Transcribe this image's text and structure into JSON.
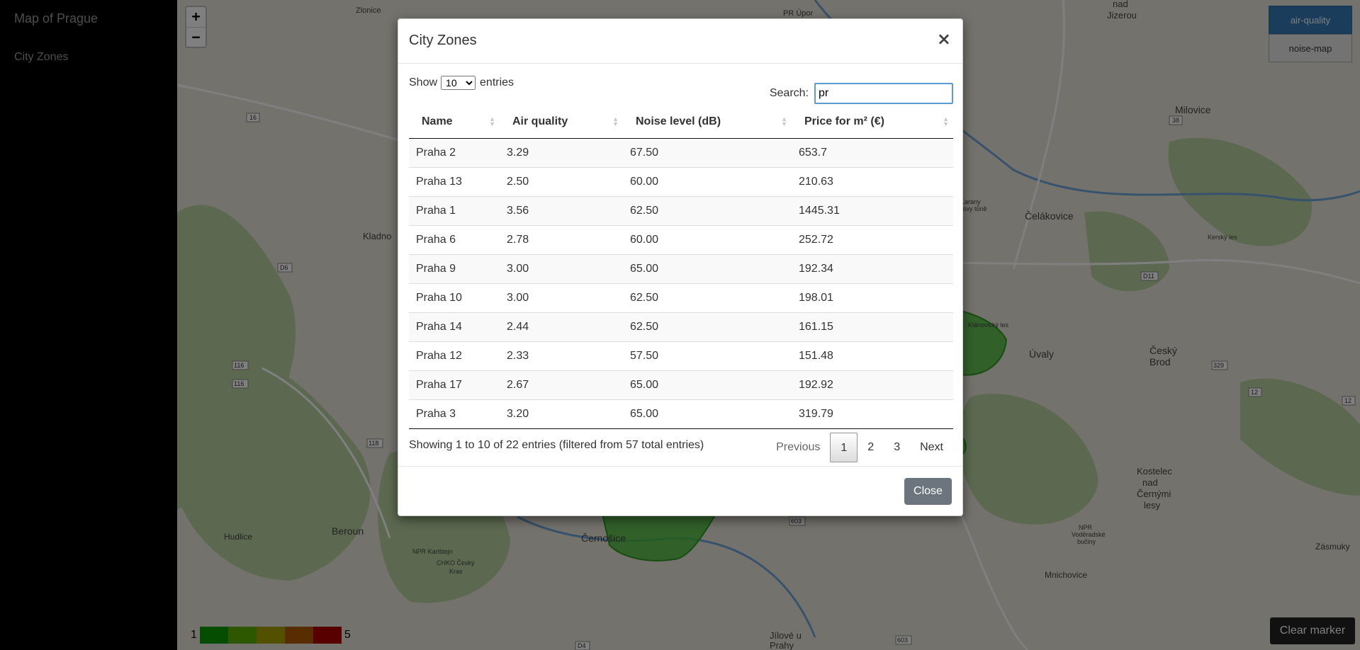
{
  "sidebar": {
    "brand": "Map of Prague",
    "items": [
      {
        "label": "City Zones"
      }
    ]
  },
  "map": {
    "zoom_in": "+",
    "zoom_out": "−",
    "layers": [
      {
        "label": "air-quality",
        "active": true
      },
      {
        "label": "noise-map",
        "active": false
      }
    ],
    "place_labels": [
      "Zlonice",
      "PR Úpor",
      "nad Jizerou",
      "Milovice",
      "Čelákovice",
      "Kladno",
      "Úvaly",
      "Český Brod",
      "Beroun",
      "Hudlice",
      "Černošice",
      "Kostelec nad Černými lesy",
      "Mnichovice",
      "Jílové u Prahy",
      "Zásmuky",
      "PR Karany Hrbáčkovy tůně",
      "Kerský les",
      "Klánovický les",
      "NPR Karlštejn",
      "CHKO Český Kras",
      "NPR Voděradské bučiny"
    ],
    "road_labels": [
      "16",
      "38",
      "D6",
      "D11",
      "116",
      "116",
      "118",
      "329",
      "12",
      "12",
      "603",
      "603",
      "D4"
    ],
    "legend": {
      "min": "1",
      "max": "5",
      "colors": [
        "#0a9a00",
        "#5db100",
        "#a6a000",
        "#b05a00",
        "#b00000"
      ]
    },
    "clear_marker": "Clear marker"
  },
  "modal": {
    "title": "City Zones",
    "close_x": "×",
    "show_label_before": "Show",
    "show_value": "10",
    "show_label_after": "entries",
    "search_label": "Search:",
    "search_value": "pr",
    "columns": [
      "Name",
      "Air quality",
      "Noise level (dB)",
      "Price for m² (€)"
    ],
    "rows": [
      [
        "Praha 2",
        "3.29",
        "67.50",
        "653.7"
      ],
      [
        "Praha 13",
        "2.50",
        "60.00",
        "210.63"
      ],
      [
        "Praha 1",
        "3.56",
        "62.50",
        "1445.31"
      ],
      [
        "Praha 6",
        "2.78",
        "60.00",
        "252.72"
      ],
      [
        "Praha 9",
        "3.00",
        "65.00",
        "192.34"
      ],
      [
        "Praha 10",
        "3.00",
        "62.50",
        "198.01"
      ],
      [
        "Praha 14",
        "2.44",
        "62.50",
        "161.15"
      ],
      [
        "Praha 12",
        "2.33",
        "57.50",
        "151.48"
      ],
      [
        "Praha 17",
        "2.67",
        "65.00",
        "192.92"
      ],
      [
        "Praha 3",
        "3.20",
        "65.00",
        "319.79"
      ]
    ],
    "info": "Showing 1 to 10 of 22 entries (filtered from 57 total entries)",
    "pager": {
      "previous": "Previous",
      "pages": [
        "1",
        "2",
        "3"
      ],
      "current": "1",
      "next": "Next"
    },
    "close_button": "Close"
  }
}
